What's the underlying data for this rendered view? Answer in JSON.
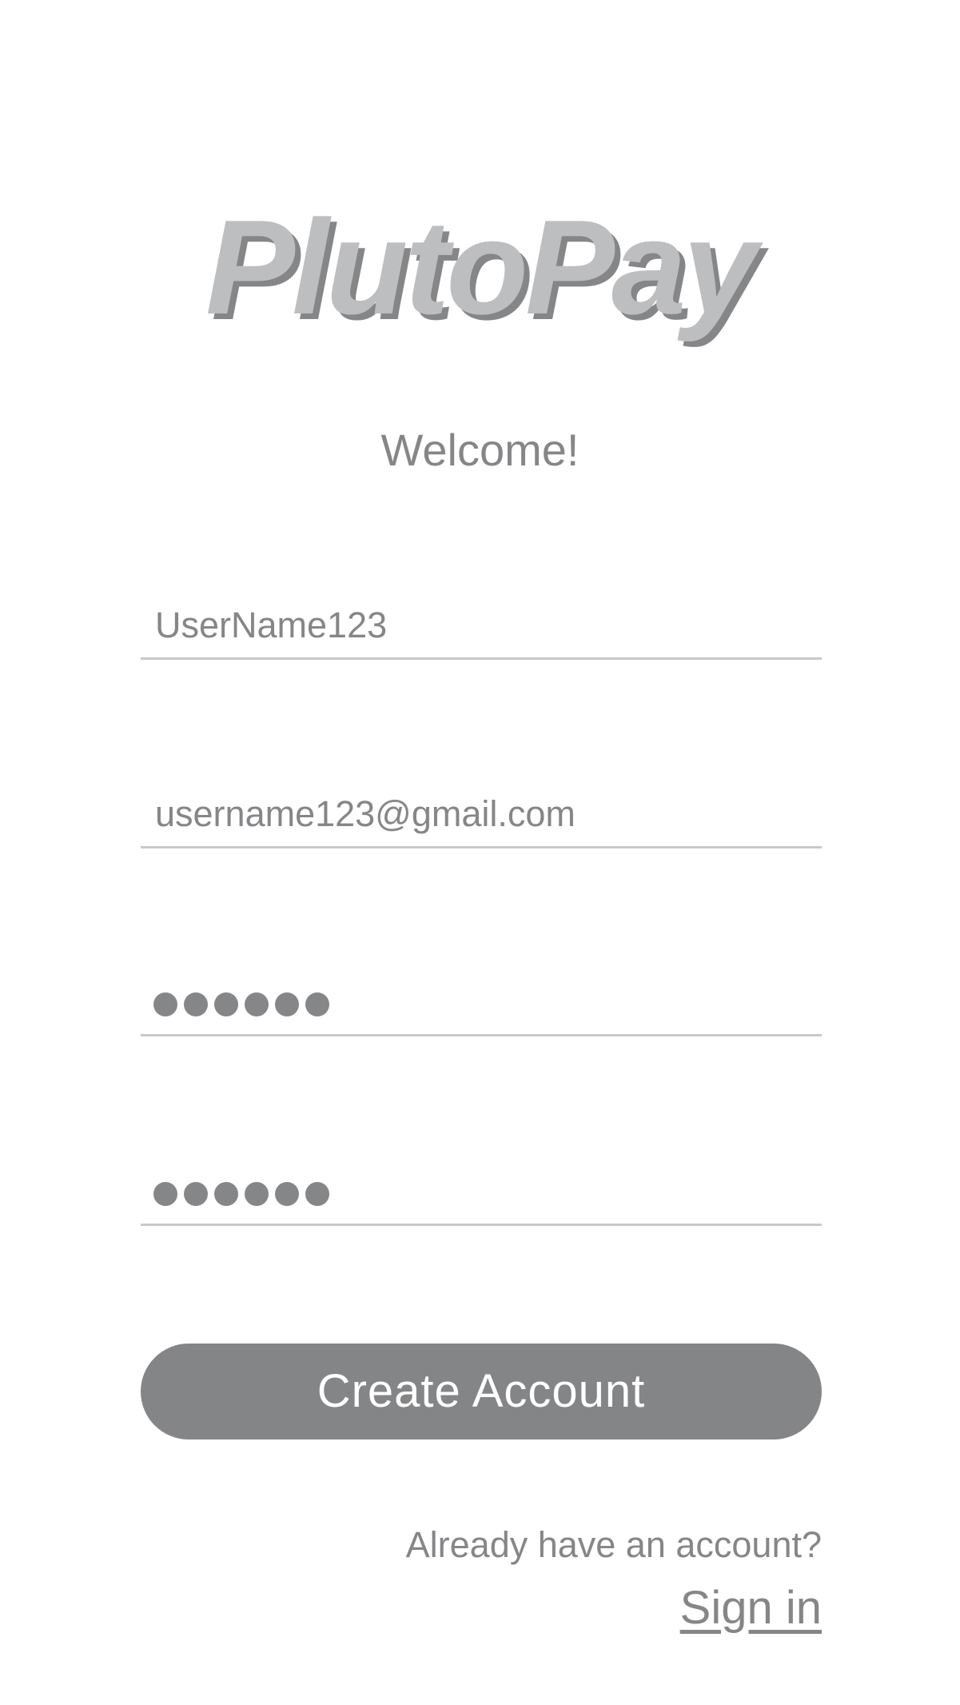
{
  "app": {
    "logo_text": "PlutoPay",
    "welcome": "Welcome!"
  },
  "form": {
    "username_value": "UserName123",
    "email_value": "username123@gmail.com",
    "password_mask_count": 6,
    "confirm_password_mask_count": 6,
    "create_button_label": "Create Account"
  },
  "footer": {
    "already_text": "Already have an account?",
    "sign_in_label": "Sign in"
  },
  "colors": {
    "logo_fill": "#bdbec0",
    "logo_shadow": "#858688",
    "text_gray": "#858688",
    "button_bg": "#848587",
    "underline": "#c8c9ca"
  }
}
